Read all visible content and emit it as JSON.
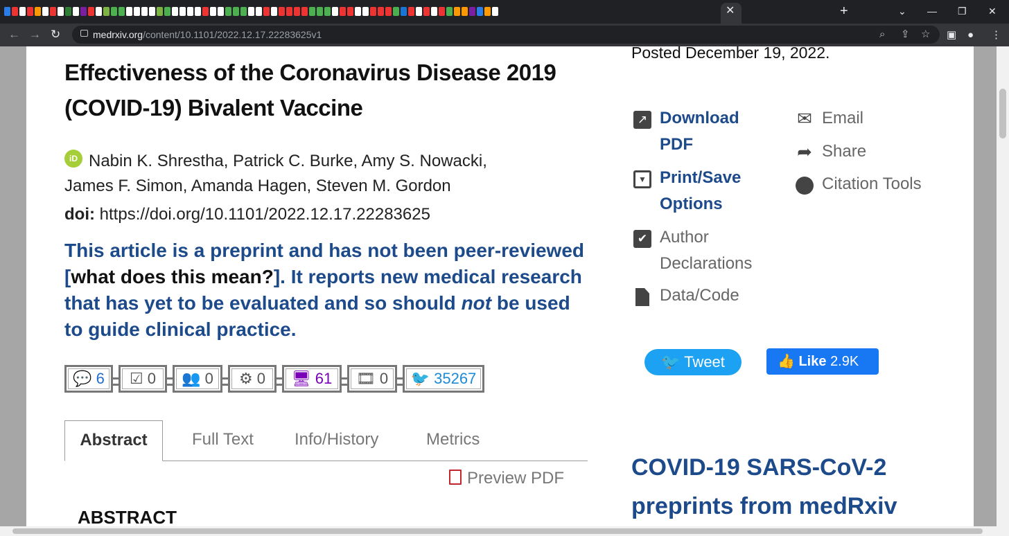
{
  "browser": {
    "tab_close": "✕",
    "new_tab": "+",
    "url_host": "medrxiv.org",
    "url_path": "/content/10.1101/2022.12.17.22283625v1",
    "back_icon": "←",
    "forward_icon": "→",
    "reload_icon": "↻",
    "window_controls": [
      "⌄",
      "—",
      "❐",
      "✕"
    ],
    "favicon_colors": [
      "#2b7de9",
      "#e33",
      "#fff",
      "#e33",
      "#f90",
      "#fff",
      "#e33",
      "#fff",
      "#2e7d32",
      "#fff",
      "#7b1fa2",
      "#e33",
      "#fff",
      "#7cb342",
      "#4caf50",
      "#4caf50",
      "#fff",
      "#fff",
      "#fff",
      "#fff",
      "#7cb342",
      "#4caf50",
      "#fff",
      "#fff",
      "#fff",
      "#fff",
      "#e33",
      "#fff",
      "#fff",
      "#4caf50",
      "#4caf50",
      "#4caf50",
      "#fff",
      "#fff",
      "#e33",
      "#fff",
      "#e33",
      "#e33",
      "#e33",
      "#e33",
      "#4caf50",
      "#4caf50",
      "#4caf50",
      "#fff",
      "#e33",
      "#e33",
      "#fff",
      "#fff",
      "#e33",
      "#e33",
      "#e33",
      "#4caf50",
      "#1976d2",
      "#e33",
      "#fff",
      "#e33",
      "#fff",
      "#e33",
      "#4caf50",
      "#f90",
      "#f90",
      "#7b1fa2",
      "#2b7de9",
      "#f90",
      "#fff"
    ]
  },
  "article": {
    "title": "Effectiveness of the Coronavirus Disease 2019 (COVID-19) Bivalent Vaccine",
    "orcid_label": "iD",
    "authors": "Nabin K. Shrestha, Patrick C. Burke, Amy S. Nowacki, James F. Simon, Amanda Hagen, Steven M. Gordon",
    "doi_label": "doi:",
    "doi_value": "https://doi.org/10.1101/2022.12.17.22283625",
    "notice_part1": "This article is a preprint and has not been peer-reviewed [",
    "notice_link": "what does this mean?",
    "notice_part2": "]. It reports new medical research that has yet to be evaluated and so should ",
    "notice_em": "not",
    "notice_part3": " be used to guide clinical practice."
  },
  "metrics": [
    {
      "icon": "💬",
      "value": "6"
    },
    {
      "icon": "☑",
      "value": "0"
    },
    {
      "icon": "👥",
      "value": "0"
    },
    {
      "icon": "⚙",
      "value": "0"
    },
    {
      "icon": "🖥",
      "value": "61"
    },
    {
      "icon": "🎞",
      "value": "0"
    },
    {
      "icon": "🐦",
      "value": "35267"
    }
  ],
  "tabs": [
    "Abstract",
    "Full Text",
    "Info/History",
    "Metrics"
  ],
  "preview_pdf": "Preview PDF",
  "abstract_heading": "ABSTRACT",
  "sidebar": {
    "posted": "Posted December 19, 2022.",
    "download_pdf": "Download PDF",
    "print_save": "Print/Save Options",
    "author_declarations": "Author Declarations",
    "data_code": "Data/Code",
    "email": "Email",
    "share": "Share",
    "citation_tools": "Citation Tools",
    "tweet": "Tweet",
    "like": "Like",
    "like_count": "2.9K",
    "covid_heading": "COVID-19 SARS-CoV-2 preprints from medRxiv"
  },
  "colors": {
    "brand_blue": "#1c4a8a",
    "twitter": "#1da1f2",
    "facebook": "#1877f2",
    "orcid": "#a6ce39"
  }
}
